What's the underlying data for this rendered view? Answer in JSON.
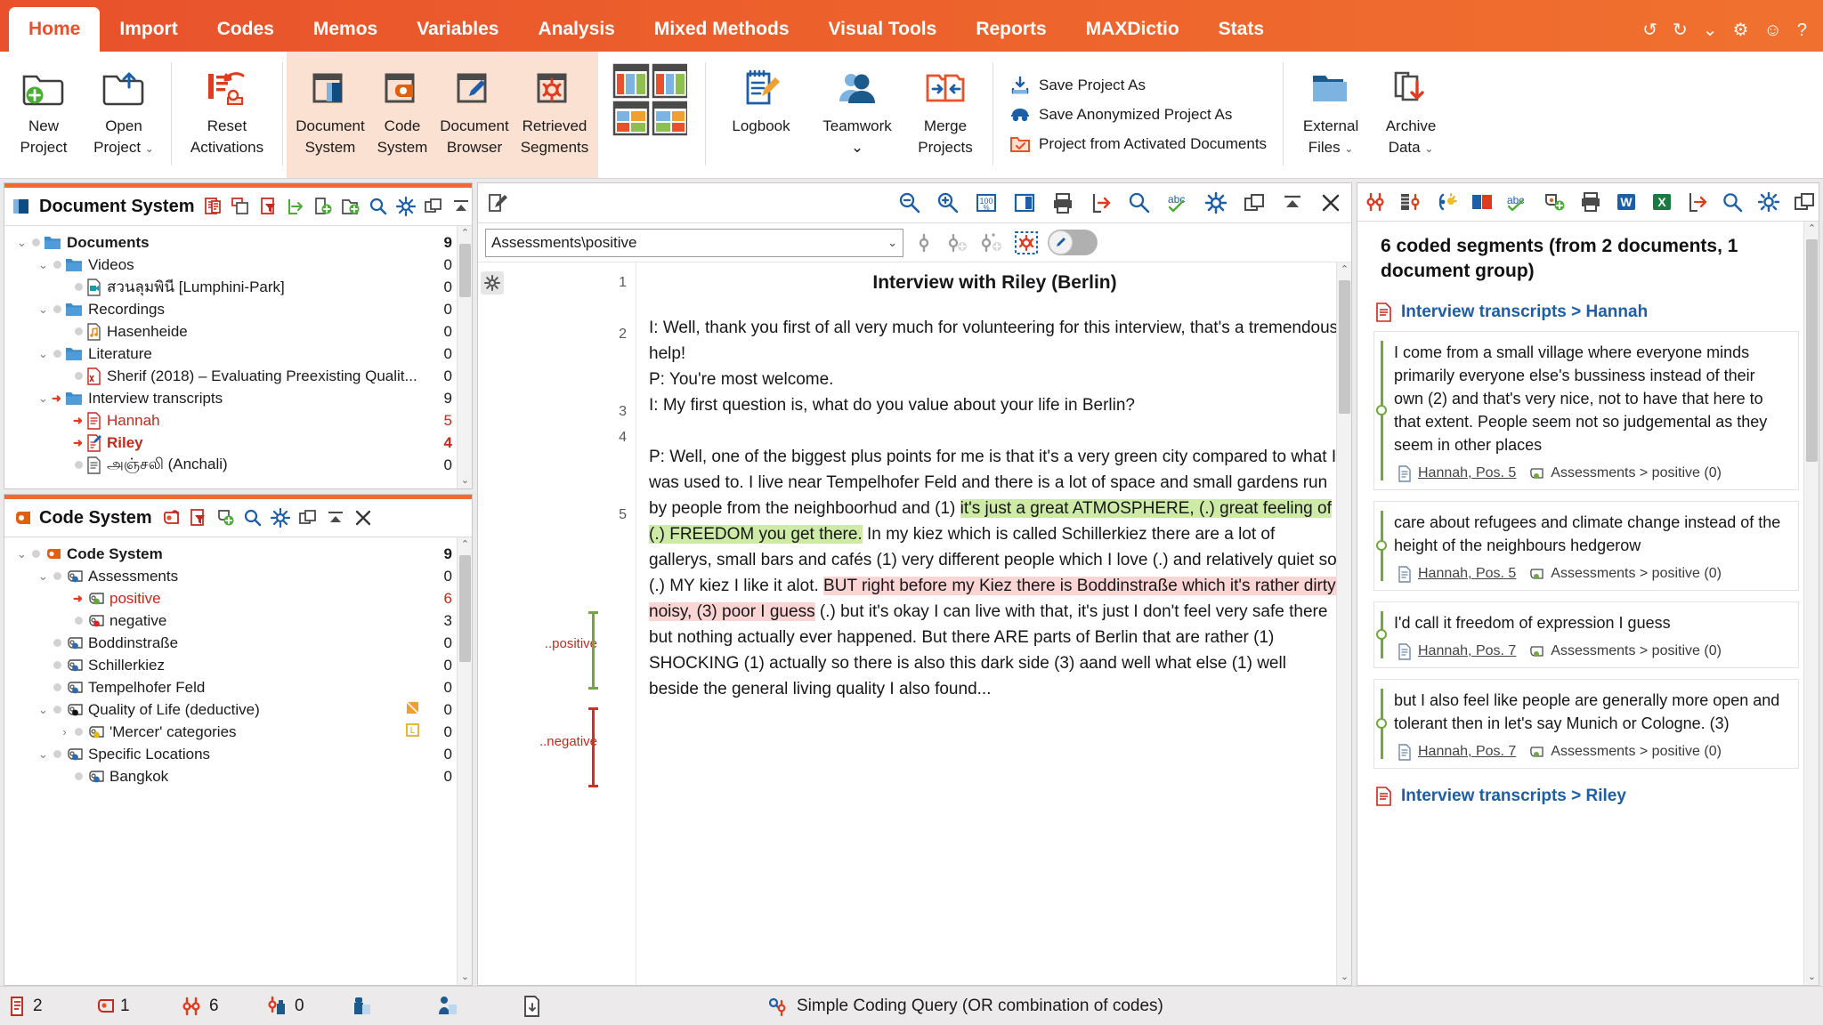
{
  "app": {
    "tabs": [
      {
        "label": "Home",
        "active": true
      },
      {
        "label": "Import",
        "active": false
      },
      {
        "label": "Codes",
        "active": false
      },
      {
        "label": "Memos",
        "active": false
      },
      {
        "label": "Variables",
        "active": false
      },
      {
        "label": "Analysis",
        "active": false
      },
      {
        "label": "Mixed Methods",
        "active": false
      },
      {
        "label": "Visual Tools",
        "active": false
      },
      {
        "label": "Reports",
        "active": false
      },
      {
        "label": "MAXDictio",
        "active": false
      },
      {
        "label": "Stats",
        "active": false
      }
    ],
    "titlebar_icons": [
      "undo-icon",
      "redo-icon",
      "chevron-down-icon",
      "gear-icon",
      "smiley-icon",
      "help-icon"
    ]
  },
  "ribbon": {
    "buttons": [
      {
        "name": "new-project",
        "line1": "New",
        "line2": "Project",
        "icon": "folder-plus-icon",
        "caret": false,
        "highlight": false
      },
      {
        "name": "open-project",
        "line1": "Open",
        "line2": "Project",
        "icon": "folder-open-up-icon",
        "caret": true,
        "highlight": false
      },
      {
        "name": "reset-activations",
        "line1": "Reset",
        "line2": "Activations",
        "icon": "reset-activations-icon",
        "caret": false,
        "highlight": false
      },
      {
        "name": "document-system",
        "line1": "Document",
        "line2": "System",
        "icon": "document-system-icon",
        "caret": false,
        "highlight": true
      },
      {
        "name": "code-system",
        "line1": "Code",
        "line2": "System",
        "icon": "code-system-icon",
        "caret": false,
        "highlight": true
      },
      {
        "name": "document-browser",
        "line1": "Document",
        "line2": "Browser",
        "icon": "document-browser-icon",
        "caret": false,
        "highlight": true
      },
      {
        "name": "retrieved-segments",
        "line1": "Retrieved",
        "line2": "Segments",
        "icon": "retrieved-segments-icon",
        "caret": false,
        "highlight": true
      },
      {
        "name": "window-layout",
        "line1": "",
        "line2": "",
        "icon": "four-pane-layout-icon",
        "caret": false,
        "highlight": false
      },
      {
        "name": "logbook",
        "line1": "Logbook",
        "line2": "",
        "icon": "logbook-icon",
        "caret": false,
        "highlight": false
      },
      {
        "name": "teamwork",
        "line1": "Teamwork",
        "line2": "",
        "icon": "teamwork-icon",
        "caret": true,
        "highlight": false
      },
      {
        "name": "merge-projects",
        "line1": "Merge",
        "line2": "Projects",
        "icon": "merge-projects-icon",
        "caret": false,
        "highlight": false
      }
    ],
    "save_list": [
      {
        "label": "Save Project As",
        "icon": "save-download-icon"
      },
      {
        "label": "Save Anonymized Project As",
        "icon": "anonymize-mask-icon"
      },
      {
        "label": "Project from Activated Documents",
        "icon": "project-activated-icon"
      }
    ],
    "right_buttons": [
      {
        "name": "external-files",
        "line1": "External",
        "line2": "Files",
        "icon": "external-files-folder-icon",
        "caret": true
      },
      {
        "name": "archive-data",
        "line1": "Archive",
        "line2": "Data",
        "icon": "archive-data-icon",
        "caret": true
      }
    ]
  },
  "document_system": {
    "title": "Document System",
    "tools": [
      "memo-icon",
      "copy-documents-icon",
      "filter-documents-icon",
      "import-icon",
      "new-document-icon",
      "new-group-icon",
      "search-icon",
      "gear-icon",
      "undock-icon",
      "collapse-icon",
      "close-icon"
    ],
    "rows": [
      {
        "label": "Documents",
        "count": "9",
        "indent": 0,
        "twist": "v",
        "icon": "folder-icon",
        "style": "bold",
        "activated": false
      },
      {
        "label": "Videos",
        "count": "0",
        "indent": 1,
        "twist": "v",
        "icon": "folder-icon",
        "style": "normal",
        "activated": false
      },
      {
        "label": "สวนลุมพินี [Lumphini-Park]",
        "count": "0",
        "indent": 2,
        "twist": "",
        "icon": "video-doc-icon",
        "style": "normal",
        "activated": false
      },
      {
        "label": "Recordings",
        "count": "0",
        "indent": 1,
        "twist": "v",
        "icon": "folder-icon",
        "style": "normal",
        "activated": false
      },
      {
        "label": "Hasenheide",
        "count": "0",
        "indent": 2,
        "twist": "",
        "icon": "audio-doc-icon",
        "style": "normal",
        "activated": false
      },
      {
        "label": "Literature",
        "count": "0",
        "indent": 1,
        "twist": "v",
        "icon": "folder-icon",
        "style": "normal",
        "activated": false
      },
      {
        "label": "Sherif (2018) – Evaluating Preexisting Qualit...",
        "count": "0",
        "indent": 2,
        "twist": "",
        "icon": "pdf-doc-icon",
        "style": "normal",
        "activated": false
      },
      {
        "label": "Interview transcripts",
        "count": "9",
        "indent": 1,
        "twist": "v",
        "icon": "folder-icon",
        "style": "normal",
        "activated": true
      },
      {
        "label": "Hannah",
        "count": "5",
        "indent": 2,
        "twist": "",
        "icon": "text-doc-icon",
        "style": "red",
        "activated": true
      },
      {
        "label": "Riley",
        "count": "4",
        "indent": 2,
        "twist": "",
        "icon": "open-doc-icon",
        "style": "redbold",
        "activated": true
      },
      {
        "label": "அஞ்சலி (Anchali)",
        "count": "0",
        "indent": 2,
        "twist": "",
        "icon": "text-doc-icon",
        "style": "normal",
        "activated": false
      }
    ]
  },
  "code_system": {
    "title": "Code System",
    "tools": [
      "code-memo-icon",
      "filter-codes-icon",
      "new-code-icon",
      "search-icon",
      "gear-icon",
      "undock-icon",
      "collapse-icon",
      "close-icon"
    ],
    "rows": [
      {
        "label": "Code System",
        "count": "9",
        "indent": 0,
        "twist": "v",
        "icon": "codesystem-icon",
        "dot": "",
        "style": "bold",
        "activated": false
      },
      {
        "label": "Assessments",
        "count": "0",
        "indent": 1,
        "twist": "v",
        "icon": "code-icon",
        "dot": "#2b6cb0",
        "style": "normal",
        "activated": false
      },
      {
        "label": "positive",
        "count": "6",
        "indent": 2,
        "twist": "",
        "icon": "code-icon",
        "dot": "#63a63b",
        "style": "red",
        "activated": true
      },
      {
        "label": "negative",
        "count": "3",
        "indent": 2,
        "twist": "",
        "icon": "code-icon",
        "dot": "#dc2626",
        "style": "normal",
        "activated": false
      },
      {
        "label": "Boddinstraße",
        "count": "0",
        "indent": 1,
        "twist": "",
        "icon": "code-icon",
        "dot": "#2b6cb0",
        "style": "normal",
        "activated": false
      },
      {
        "label": "Schillerkiez",
        "count": "0",
        "indent": 1,
        "twist": "",
        "icon": "code-icon",
        "dot": "#2b6cb0",
        "style": "normal",
        "activated": false
      },
      {
        "label": "Tempelhofer Feld",
        "count": "0",
        "indent": 1,
        "twist": "",
        "icon": "code-icon",
        "dot": "#2b6cb0",
        "style": "normal",
        "activated": false
      },
      {
        "label": "Quality of Life (deductive)",
        "count": "0",
        "indent": 1,
        "twist": "v",
        "icon": "code-icon",
        "dot": "#101010",
        "style": "normal",
        "activated": false
      },
      {
        "label": "'Mercer' categories",
        "count": "0",
        "indent": 2,
        "twist": ">",
        "icon": "code-icon",
        "dot": "#e6b800",
        "style": "normal",
        "activated": false
      },
      {
        "label": "Specific Locations",
        "count": "0",
        "indent": 1,
        "twist": "v",
        "icon": "code-icon",
        "dot": "#2b6cb0",
        "style": "normal",
        "activated": false
      },
      {
        "label": "Bangkok",
        "count": "0",
        "indent": 2,
        "twist": "",
        "icon": "code-icon",
        "dot": "#2b6cb0",
        "style": "normal",
        "activated": false
      }
    ]
  },
  "document_browser": {
    "toolbar_icons": [
      "edit-mode-icon",
      "zoom-out-icon",
      "zoom-in-icon",
      "zoom-100-icon",
      "split-view-icon",
      "print-icon",
      "export-icon",
      "search-icon",
      "spellcheck-icon",
      "gear-icon",
      "undock-icon",
      "collapse-icon",
      "close-icon"
    ],
    "code_combo_value": "Assessments\\positive",
    "code_toolbar_icons": [
      "code-inline-icon",
      "code-add-icon",
      "code-info-add-icon",
      "code-highlight-icon"
    ],
    "edit_toggle_on": false,
    "doc_title": "Interview with Riley (Berlin)",
    "paragraphs": [
      {
        "num": "1",
        "text": "",
        "title": true
      },
      {
        "num": "2",
        "text": "I: Well, thank you first of all very much for volunteering for this interview, that's a tremendous help!"
      },
      {
        "num": "3",
        "text": "P: You're most welcome."
      },
      {
        "num": "4",
        "text": "I: My first question is, what do you value about your life in Berlin?"
      },
      {
        "num": "5",
        "text": "P: Well, one of the biggest plus points for me is that it's a very green city compared to what I was used to. I live near Tempelhofer Feld and there is a lot of space and small gardens run by people from the neighboorhud and (1) "
      }
    ],
    "highlight_green": "it's just a great ATMOSPHERE, (.) great feeling of (.) FREEDOM you get there.",
    "text_after_green": " In my kiez which is called Schillerkiez there are a lot of gallerys, small bars and cafés (1) very different people which I love (.) and relatively quiet so (.) MY kiez I like it alot. ",
    "highlight_red": "BUT right before my Kiez there is Boddinstraße which it's rather dirty, noisy, (3) poor I guess",
    "text_after_red": " (.) but it's okay I can live with that, it's just I don't feel very safe there but nothing actually ever happened. But there ARE parts of Berlin that are rather (1) SHOCKING (1) actually so there is also this dark side (3) aand well what else (1) well beside the general living quality I also found...",
    "stripe_positive": "..positive",
    "stripe_negative": "..negative"
  },
  "retrieved_segments": {
    "toolbar_icons": [
      "coded-segments-icon",
      "table-segments-icon",
      "smart-coding-icon",
      "summary-icon",
      "abc-icon",
      "add-code-icon",
      "print-icon",
      "word-export-icon",
      "excel-export-icon",
      "export-icon",
      "search-icon",
      "gear-icon",
      "undock-icon",
      "collapse-icon",
      "close-icon"
    ],
    "summary": "6 coded segments (from 2 documents, 1 document group)",
    "groups": [
      {
        "source": "Interview transcripts > Hannah",
        "segments": [
          {
            "text": "I come from a small village where everyone minds primarily everyone else's bussiness instead of their own (2) and that's very nice, not to have that here to that extent. People seem not so judgemental as they seem in other places",
            "position": "Hannah, Pos. 5",
            "code": "Assessments > positive (0)",
            "color": "#6fa83d"
          },
          {
            "text": "care about refugees and climate change instead of the height of the neighbours hedgerow",
            "position": "Hannah, Pos. 5",
            "code": "Assessments > positive (0)",
            "color": "#6fa83d"
          },
          {
            "text": "I'd call it freedom of expression I guess",
            "position": "Hannah, Pos. 7",
            "code": "Assessments > positive (0)",
            "color": "#6fa83d"
          },
          {
            "text": "but I also feel like people are generally more open and tolerant then in let's say Munich or Cologne. (3)",
            "position": "Hannah, Pos. 7",
            "code": "Assessments > positive (0)",
            "color": "#6fa83d"
          }
        ]
      },
      {
        "source": "Interview transcripts > Riley",
        "segments": []
      }
    ]
  },
  "statusbar": {
    "items": [
      {
        "name": "documents-count",
        "value": "2",
        "icon": "text-doc-icon"
      },
      {
        "name": "codes-count",
        "value": "1",
        "icon": "code-icon"
      },
      {
        "name": "coded-segments-count",
        "value": "6",
        "icon": "coded-segments-icon"
      },
      {
        "name": "memos-count",
        "value": "0",
        "icon": "coded-memo-icon"
      },
      {
        "name": "doc-variables",
        "value": "",
        "icon": "doc-variable-icon"
      },
      {
        "name": "code-variables",
        "value": "",
        "icon": "code-variable-icon"
      },
      {
        "name": "document-export",
        "value": "",
        "icon": "doc-down-icon"
      }
    ],
    "query": "Simple Coding Query (OR combination of codes)",
    "query_icon": "coding-query-icon"
  },
  "colors": {
    "brand_orange": "#e8512c",
    "ribbon_highlight": "#fbe1d2",
    "accent_blue": "#1d5ea8",
    "code_red": "#c5281c",
    "green_highlight": "#cdeaa6",
    "red_highlight": "#fbd4d4",
    "segment_green": "#6fa83d"
  }
}
